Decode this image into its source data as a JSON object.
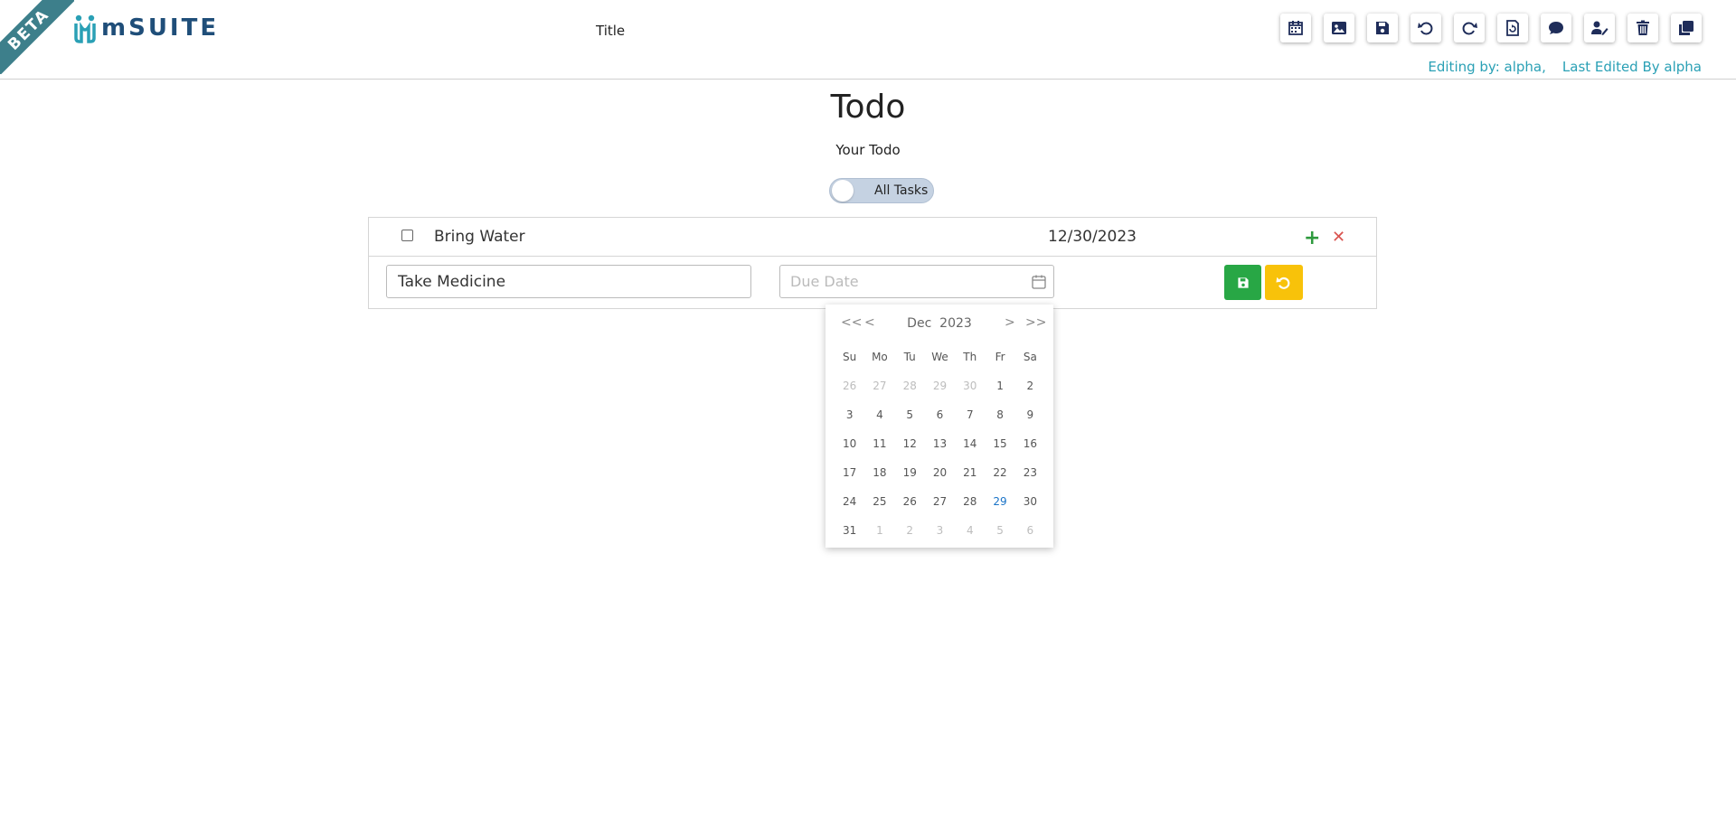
{
  "header": {
    "beta_label": "BETA",
    "logo_text": "mSUITE",
    "title": "Title",
    "toolbar": [
      {
        "name": "calendar-icon",
        "label": "Calendar"
      },
      {
        "name": "image-icon",
        "label": "Image"
      },
      {
        "name": "save-icon",
        "label": "Save"
      },
      {
        "name": "undo-icon",
        "label": "Undo"
      },
      {
        "name": "redo-icon",
        "label": "Redo"
      },
      {
        "name": "restore-icon",
        "label": "Restore"
      },
      {
        "name": "comment-icon",
        "label": "Comment"
      },
      {
        "name": "user-edit-icon",
        "label": "Edit users"
      },
      {
        "name": "trash-icon",
        "label": "Delete"
      },
      {
        "name": "copy-icon",
        "label": "Copy"
      }
    ],
    "editing_by": "Editing by: alpha,",
    "last_edited": "Last Edited By alpha"
  },
  "main": {
    "title": "Todo",
    "subtitle": "Your Todo",
    "toggle_label": "All Tasks"
  },
  "todos": [
    {
      "text": "Bring Water",
      "date": "12/30/2023",
      "checked": false
    }
  ],
  "edit_row": {
    "task_value": "Take Medicine",
    "date_placeholder": "Due Date"
  },
  "calendar": {
    "month": "Dec",
    "year": "2023",
    "prev_year": "<<",
    "prev_month": "<",
    "next_month": ">",
    "next_year": ">>",
    "weekdays": [
      "Su",
      "Mo",
      "Tu",
      "We",
      "Th",
      "Fr",
      "Sa"
    ],
    "weeks": [
      [
        {
          "d": "26",
          "o": true
        },
        {
          "d": "27",
          "o": true
        },
        {
          "d": "28",
          "o": true
        },
        {
          "d": "29",
          "o": true
        },
        {
          "d": "30",
          "o": true
        },
        {
          "d": "1"
        },
        {
          "d": "2"
        }
      ],
      [
        {
          "d": "3"
        },
        {
          "d": "4"
        },
        {
          "d": "5"
        },
        {
          "d": "6"
        },
        {
          "d": "7"
        },
        {
          "d": "8"
        },
        {
          "d": "9"
        }
      ],
      [
        {
          "d": "10"
        },
        {
          "d": "11"
        },
        {
          "d": "12"
        },
        {
          "d": "13"
        },
        {
          "d": "14"
        },
        {
          "d": "15"
        },
        {
          "d": "16"
        }
      ],
      [
        {
          "d": "17"
        },
        {
          "d": "18"
        },
        {
          "d": "19"
        },
        {
          "d": "20"
        },
        {
          "d": "21"
        },
        {
          "d": "22"
        },
        {
          "d": "23"
        }
      ],
      [
        {
          "d": "24"
        },
        {
          "d": "25"
        },
        {
          "d": "26"
        },
        {
          "d": "27"
        },
        {
          "d": "28"
        },
        {
          "d": "29",
          "t": true
        },
        {
          "d": "30"
        }
      ],
      [
        {
          "d": "31"
        },
        {
          "d": "1",
          "o": true
        },
        {
          "d": "2",
          "o": true
        },
        {
          "d": "3",
          "o": true
        },
        {
          "d": "4",
          "o": true
        },
        {
          "d": "5",
          "o": true
        },
        {
          "d": "6",
          "o": true
        }
      ]
    ]
  },
  "colors": {
    "accent": "#2aa0b5",
    "brand": "#1f4e79",
    "save": "#28a745",
    "undo": "#f8c20a",
    "delete": "#d9534f"
  }
}
